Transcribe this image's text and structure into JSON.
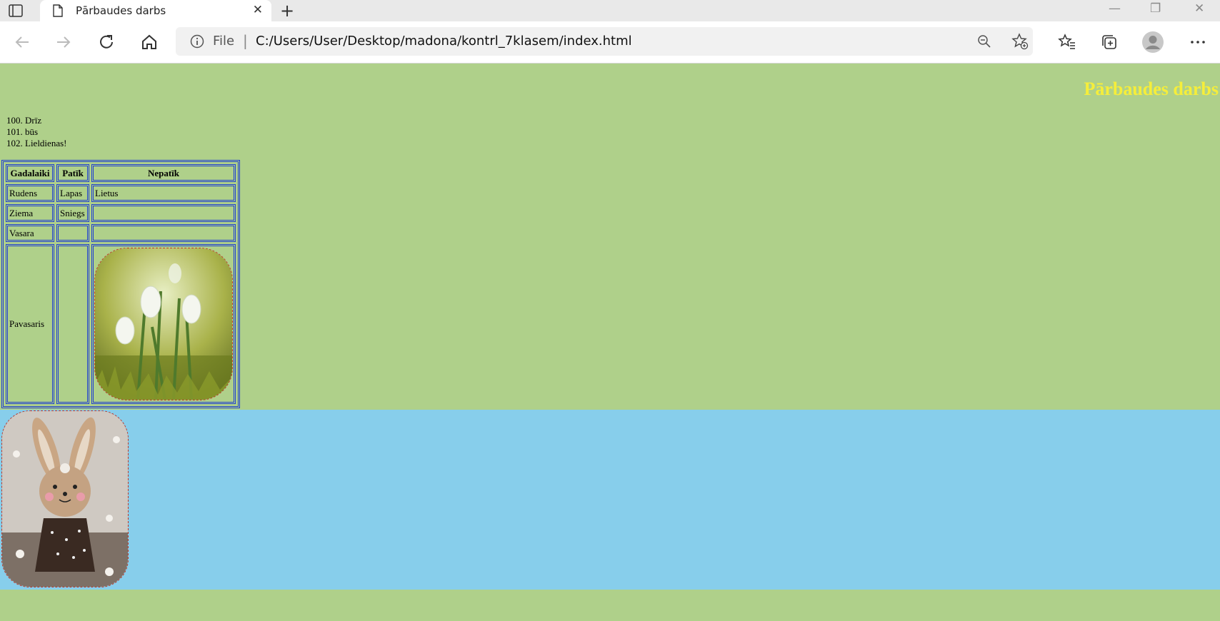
{
  "browser": {
    "tab_title": "Pārbaudes darbs",
    "tab_close": "✕",
    "new_tab": "+",
    "address_scheme": "File",
    "address_separator": "|",
    "url": "C:/Users/User/Desktop/madona/kontrl_7klasem/index.html",
    "window_controls": [
      "—",
      "❐",
      "✕"
    ]
  },
  "page": {
    "heading": "Pārbaudes darbs",
    "list_start": 100,
    "list_items": [
      "Drīz",
      "būs",
      "Lieldienas!"
    ],
    "table": {
      "headers": [
        "Gadalaiki",
        "Patīk",
        "Nepatīk"
      ],
      "rows": [
        [
          "Rudens",
          "Lapas",
          "Lietus"
        ],
        [
          "Ziema",
          "Sniegs",
          ""
        ],
        [
          "Vasara",
          "",
          ""
        ],
        [
          "Pavasaris",
          "",
          ""
        ]
      ]
    }
  },
  "colors": {
    "page_bg": "#afd08a",
    "heading": "#f6ee3a",
    "table_border": "#1f3fd0",
    "blue_band": "#87ceeb",
    "image_border": "#c0392b"
  }
}
